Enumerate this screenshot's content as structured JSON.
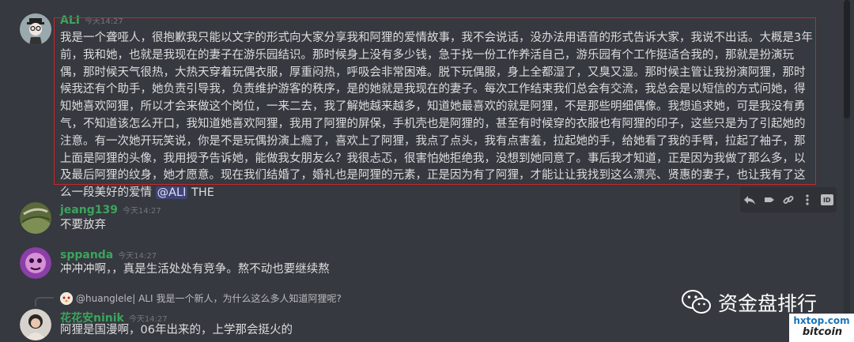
{
  "messages": [
    {
      "author": "ALI",
      "author_color": "#3ba55c",
      "timestamp": "今天14:27",
      "lines": [
        "我是一个聋哑人，很抱歉我只能以文字的形式向大家分享我和阿狸的爱情故事，我不会说话，没办法用语音的形式告诉大家，我说不出话。大概是3年",
        "前，我和她，也就是我现在的妻子在游乐园结识。那时候身上没有多少钱，急于找一份工作养活自己，游乐园有个工作挺适合我的，那就是扮演玩",
        "偶，那时候天气很热，大热天穿着玩偶衣服，厚重闷热，呼吸会非常困难。脱下玩偶服，身上全都湿了，又臭又湿。那时候主管让我扮演阿狸，那时",
        "候我还有个助手，她负责引导我，负责维护游客的秩序，是的她就是我现在的妻子。每次工作结束我们总会有交流，我总会是以短信的方式问她，得",
        "知她喜欢阿狸，所以才会来做这个岗位，一来二去，我了解她越来越多，知道她最喜欢的就是阿狸，不是那些明细偶像。我想追求她，可是我没有勇",
        "气，不知道该怎么开口，我知道她喜欢阿狸，我用了阿狸的屏保，手机壳也是阿狸的，甚至有时候穿的衣服也有阿狸的印子，这些只是为了引起她的",
        "注意。有一次她开玩笑说，你是不是玩偶扮演上瘾了，喜欢上了阿狸，我点了点头，我有点害羞，拉起她的手，给她看了我的手臂，拉起了袖子，那",
        "上面是阿狸的头像，我用授予告诉她，能做我女朋友么？我很忐忑，很害怕她拒绝我，没想到她同意了。事后我才知道，正是因为我做了那么多，以",
        "及最后阿狸的纹身，她才愿意。现在我们结婚了，婚礼也是阿狸的元素，正是因为有了阿狸，才能让让我找到这么漂亮、贤惠的妻子，也让我有了这",
        "么一段美好的爱情"
      ],
      "mention": "@ALI",
      "trailing": "THE"
    },
    {
      "author": "jeang139",
      "author_color": "#3ba55c",
      "timestamp": "今天14:27",
      "lines": [
        "不要放弃"
      ]
    },
    {
      "author": "sppanda",
      "author_color": "#3ba55c",
      "timestamp": "今天14:27",
      "lines": [
        "冲冲冲啊，，真是生活处处有竞争。熬不动也要继续熬"
      ]
    },
    {
      "author": "花花安ninik",
      "author_color": "#3ba55c",
      "timestamp": "今天14:27",
      "reply": {
        "name": "@huanglele| ALI",
        "text": "我是一个新人，为什么这么多人知道阿狸呢?"
      },
      "lines": [
        "阿狸是国漫啊，06年出来的，上学那会挺火的"
      ]
    }
  ],
  "toolbar": [
    "reply-icon",
    "forward-icon",
    "link-icon",
    "more-icon",
    "id-icon"
  ],
  "toolbar_id_label": "ID",
  "watermark": {
    "text": "资金盘排行",
    "site": "hxtop.com",
    "brand": "bitcoin"
  },
  "colors": {
    "background": "#36393f",
    "highlight_border": "#c8272f",
    "text": "#dcddde"
  }
}
